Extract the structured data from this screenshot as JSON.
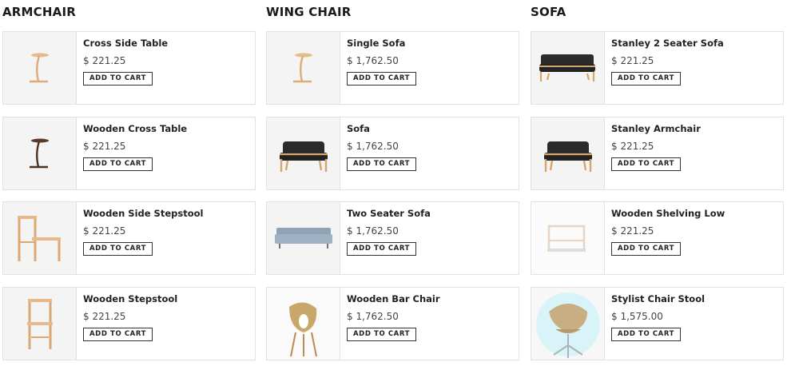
{
  "columns": [
    {
      "title": "ARMCHAIR",
      "products": [
        {
          "name": "Cross Side Table",
          "price": "$ 221.25",
          "button": "ADD TO CART",
          "image": "cross-side-table-image"
        },
        {
          "name": "Wooden Cross Table",
          "price": "$ 221.25",
          "button": "ADD TO CART",
          "image": "wooden-cross-table-image"
        },
        {
          "name": "Wooden Side Stepstool",
          "price": "$ 221.25",
          "button": "ADD TO CART",
          "image": "wooden-side-stepstool-image"
        },
        {
          "name": "Wooden Stepstool",
          "price": "$ 221.25",
          "button": "ADD TO CART",
          "image": "wooden-stepstool-image"
        }
      ]
    },
    {
      "title": "WING CHAIR",
      "products": [
        {
          "name": "Single Sofa",
          "price": "$ 1,762.50",
          "button": "ADD TO CART",
          "image": "single-sofa-image"
        },
        {
          "name": "Sofa",
          "price": "$ 1,762.50",
          "button": "ADD TO CART",
          "image": "sofa-image"
        },
        {
          "name": "Two Seater Sofa",
          "price": "$ 1,762.50",
          "button": "ADD TO CART",
          "image": "two-seater-sofa-image"
        },
        {
          "name": "Wooden Bar Chair",
          "price": "$ 1,762.50",
          "button": "ADD TO CART",
          "image": "wooden-bar-chair-image"
        }
      ]
    },
    {
      "title": "SOFA",
      "products": [
        {
          "name": "Stanley 2 Seater Sofa",
          "price": "$ 221.25",
          "button": "ADD TO CART",
          "image": "stanley-2-seater-sofa-image"
        },
        {
          "name": "Stanley Armchair",
          "price": "$ 221.25",
          "button": "ADD TO CART",
          "image": "stanley-armchair-image"
        },
        {
          "name": "Wooden Shelving Low",
          "price": "$ 221.25",
          "button": "ADD TO CART",
          "image": "wooden-shelving-low-image"
        },
        {
          "name": "Stylist Chair Stool",
          "price": "$ 1,575.00",
          "button": "ADD TO CART",
          "image": "stylist-chair-stool-image"
        }
      ]
    }
  ]
}
